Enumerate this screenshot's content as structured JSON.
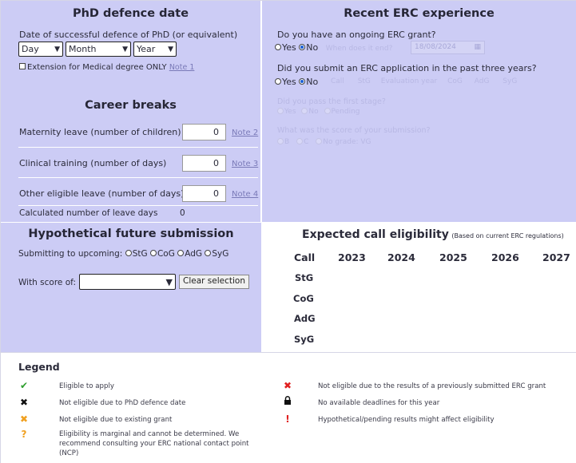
{
  "phd": {
    "title": "PhD defence date",
    "date_label": "Date of successful defence of PhD (or equivalent)",
    "day": "Day",
    "month": "Month",
    "year": "Year",
    "extension_label": "Extension for Medical degree ONLY",
    "extension_note": "Note 1"
  },
  "career": {
    "title": "Career breaks",
    "maternity_label": "Maternity leave (number of children)",
    "maternity_value": "0",
    "maternity_note": "Note 2",
    "clinical_label": "Clinical training (number of days)",
    "clinical_value": "0",
    "clinical_note": "Note 3",
    "other_label": "Other eligible leave (number of days)",
    "other_value": "0",
    "other_note": "Note 4",
    "calc_label": "Calculated number of leave days",
    "calc_value": "0"
  },
  "erc": {
    "title": "Recent ERC experience",
    "q1": "Do you have an ongoing ERC grant?",
    "yes": "Yes",
    "no": "No",
    "q1_when": "When does it end?",
    "q1_date": "18/08/2024",
    "q2": "Did you submit an ERC application in the past three years?",
    "q2_opts": [
      "Call",
      "StG",
      "Evaluation year",
      "CoG",
      "AdG",
      "SyG"
    ],
    "q3": "Did you pass the first stage?",
    "q3_opts": [
      "Yes",
      "No",
      "Pending"
    ],
    "q4": "What was the score of your submission?",
    "q4_opts": [
      "B",
      "C",
      "No grade: VG"
    ]
  },
  "hyp": {
    "title": "Hypothetical future submission",
    "submit_label": "Submitting to upcoming:",
    "opts": [
      "StG",
      "CoG",
      "AdG",
      "SyG"
    ],
    "score_label": "With score of:",
    "clear_button": "Clear selection"
  },
  "expected": {
    "title": "Expected call eligibility",
    "subtitle": "(Based on current ERC regulations)",
    "call_header": "Call",
    "years": [
      "2023",
      "2024",
      "2025",
      "2026",
      "2027"
    ],
    "calls": [
      "StG",
      "CoG",
      "AdG",
      "SyG"
    ]
  },
  "legend": {
    "title": "Legend",
    "left": [
      {
        "icon": "check-icon",
        "glyph": "✔",
        "color": "#2e9e2e",
        "text": "Eligible to apply"
      },
      {
        "icon": "cross-black-icon",
        "glyph": "✖",
        "color": "#111111",
        "text": "Not eligible due to PhD defence date"
      },
      {
        "icon": "cross-orange-icon",
        "glyph": "✖",
        "color": "#f0a020",
        "text": "Not eligible due to existing grant"
      },
      {
        "icon": "question-icon",
        "glyph": "?",
        "color": "#f0a020",
        "text": "Eligibility is marginal and cannot be determined. We recommend consulting your ERC national contact point (NCP)"
      }
    ],
    "right": [
      {
        "icon": "cross-red-icon",
        "glyph": "✖",
        "color": "#e02020",
        "text": "Not eligible due to the results of a previously submitted ERC grant"
      },
      {
        "icon": "lock-icon",
        "glyph": "🔒",
        "color": "#111111",
        "text": "No available deadlines for this year"
      },
      {
        "icon": "exclamation-icon",
        "glyph": "!",
        "color": "#e02020",
        "text": "Hypothetical/pending results might affect eligibility"
      }
    ]
  }
}
